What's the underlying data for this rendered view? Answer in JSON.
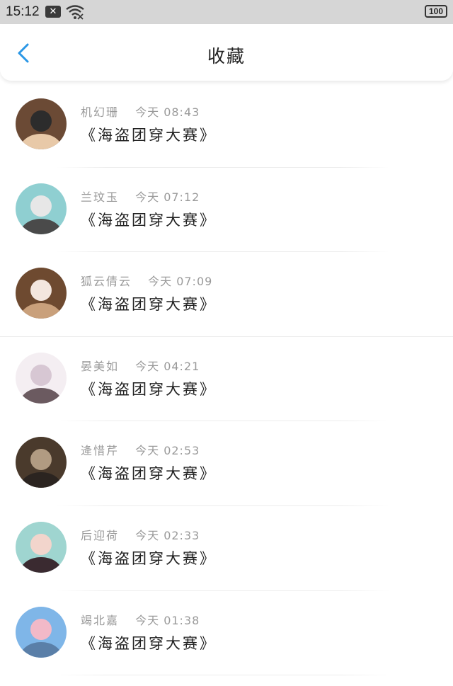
{
  "status_bar": {
    "time": "15:12",
    "notification_glyph": "✕",
    "battery": "100",
    "icons": [
      "notification-x-icon",
      "wifi-icon",
      "battery-icon"
    ]
  },
  "header": {
    "title": "收藏",
    "back_icon": "chevron-left-icon",
    "accent_color": "#2a97e6"
  },
  "favorites": [
    {
      "author": "机幻珊",
      "time": "今天 08:43",
      "title": "《海盗团穿大赛》",
      "avatar_colors": [
        "#6b4a35",
        "#2c2c2c",
        "#e8c9a8"
      ]
    },
    {
      "author": "兰玟玉",
      "time": "今天 07:12",
      "title": "《海盗团穿大赛》",
      "avatar_colors": [
        "#8fcfd1",
        "#e7e7e7",
        "#4a4a4a"
      ]
    },
    {
      "author": "狐云倩云",
      "time": "今天 07:09",
      "title": "《海盗团穿大赛》",
      "avatar_colors": [
        "#6e4a30",
        "#f3e6de",
        "#c9a07b"
      ]
    },
    {
      "author": "晏美如",
      "time": "今天 04:21",
      "title": "《海盗团穿大赛》",
      "avatar_colors": [
        "#f4eef2",
        "#d7c7d3",
        "#6b5a60"
      ]
    },
    {
      "author": "逄惜芹",
      "time": "今天 02:53",
      "title": "《海盗团穿大赛》",
      "avatar_colors": [
        "#4a3a2c",
        "#b19b82",
        "#2b2420"
      ]
    },
    {
      "author": "后迎荷",
      "time": "今天 02:33",
      "title": "《海盗团穿大赛》",
      "avatar_colors": [
        "#9fd5d0",
        "#f2d5cc",
        "#3a2a30"
      ]
    },
    {
      "author": "竭北嘉",
      "time": "今天 01:38",
      "title": "《海盗团穿大赛》",
      "avatar_colors": [
        "#7fb6e8",
        "#f2b9c8",
        "#5a7fa8"
      ]
    }
  ]
}
